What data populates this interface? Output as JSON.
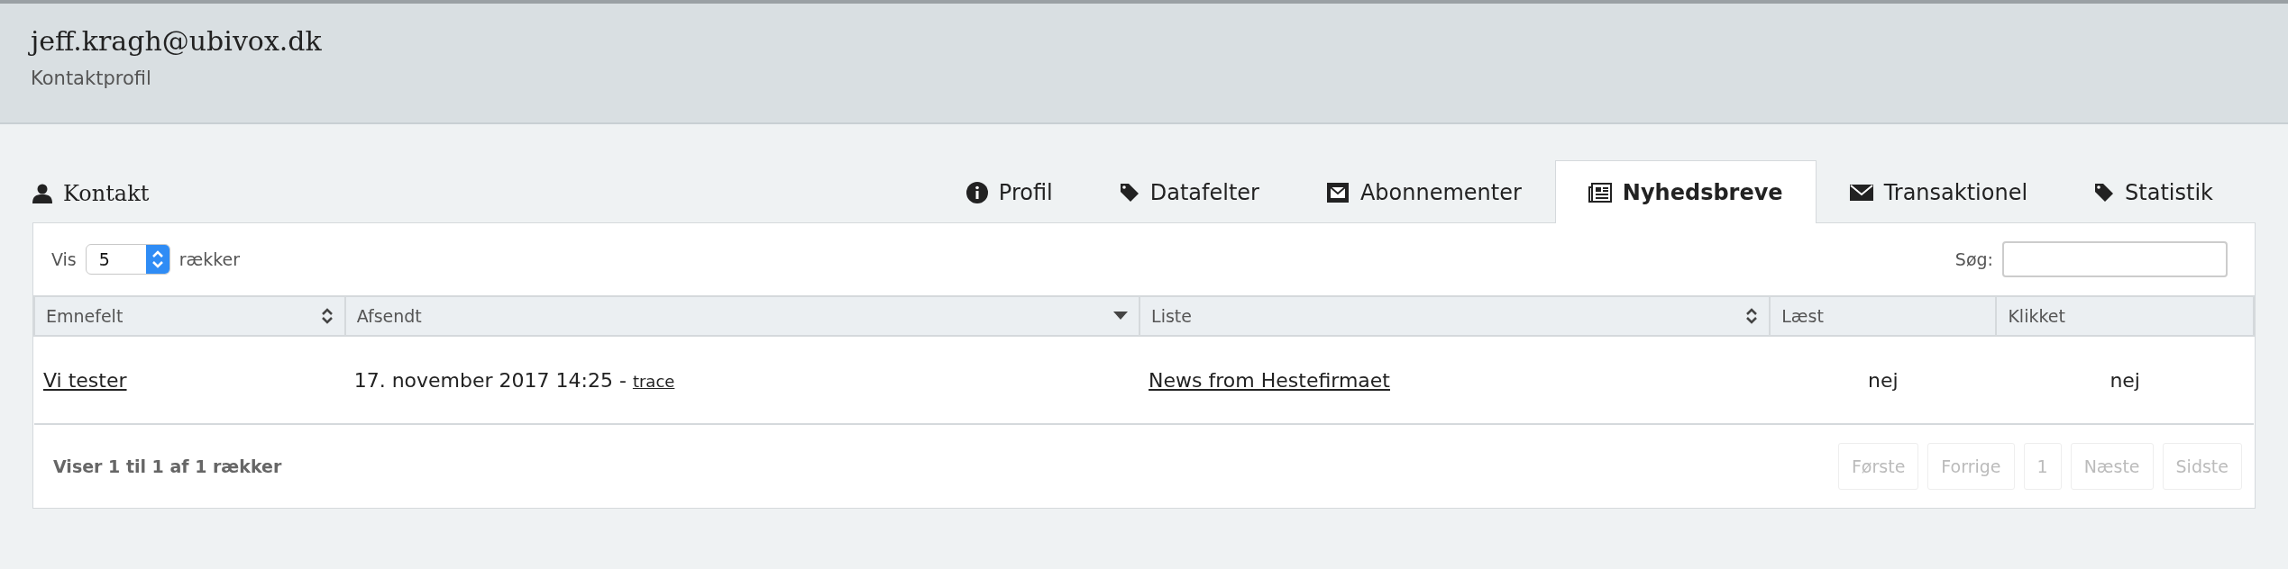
{
  "header": {
    "title": "jeff.kragh@ubivox.dk",
    "subtitle": "Kontaktprofil"
  },
  "section": {
    "title": "Kontakt"
  },
  "tabs": [
    {
      "label": "Profil",
      "kind": "info",
      "selected": false
    },
    {
      "label": "Datafelter",
      "kind": "tag",
      "selected": false
    },
    {
      "label": "Abonnementer",
      "kind": "stamp",
      "selected": false
    },
    {
      "label": "Nyhedsbreve",
      "kind": "news",
      "selected": true
    },
    {
      "label": "Transaktionel",
      "kind": "mail",
      "selected": false
    },
    {
      "label": "Statistik",
      "kind": "tag",
      "selected": false
    }
  ],
  "length": {
    "label_before": "Vis",
    "value": "5",
    "label_after": "rækker"
  },
  "search": {
    "label": "Søg:"
  },
  "table": {
    "columns": [
      {
        "label": "Emnefelt",
        "kind": "sortable"
      },
      {
        "label": "Afsendt",
        "kind": "sorted-desc"
      },
      {
        "label": "Liste",
        "kind": "sortable"
      },
      {
        "label": "Læst",
        "kind": "plain"
      },
      {
        "label": "Klikket",
        "kind": "plain"
      }
    ],
    "rows": [
      {
        "subject": "Vi tester",
        "sent": "17. november 2017 14:25 - ",
        "trace": "trace",
        "list": "News from Hestefirmaet",
        "read": "nej",
        "clicked": "nej"
      }
    ]
  },
  "info": "Viser 1 til 1 af 1 rækker",
  "pagination": [
    {
      "label": "Første",
      "disabled": true
    },
    {
      "label": "Forrige",
      "disabled": true
    },
    {
      "label": "1",
      "disabled": true
    },
    {
      "label": "Næste",
      "disabled": true
    },
    {
      "label": "Sidste",
      "disabled": true
    }
  ]
}
